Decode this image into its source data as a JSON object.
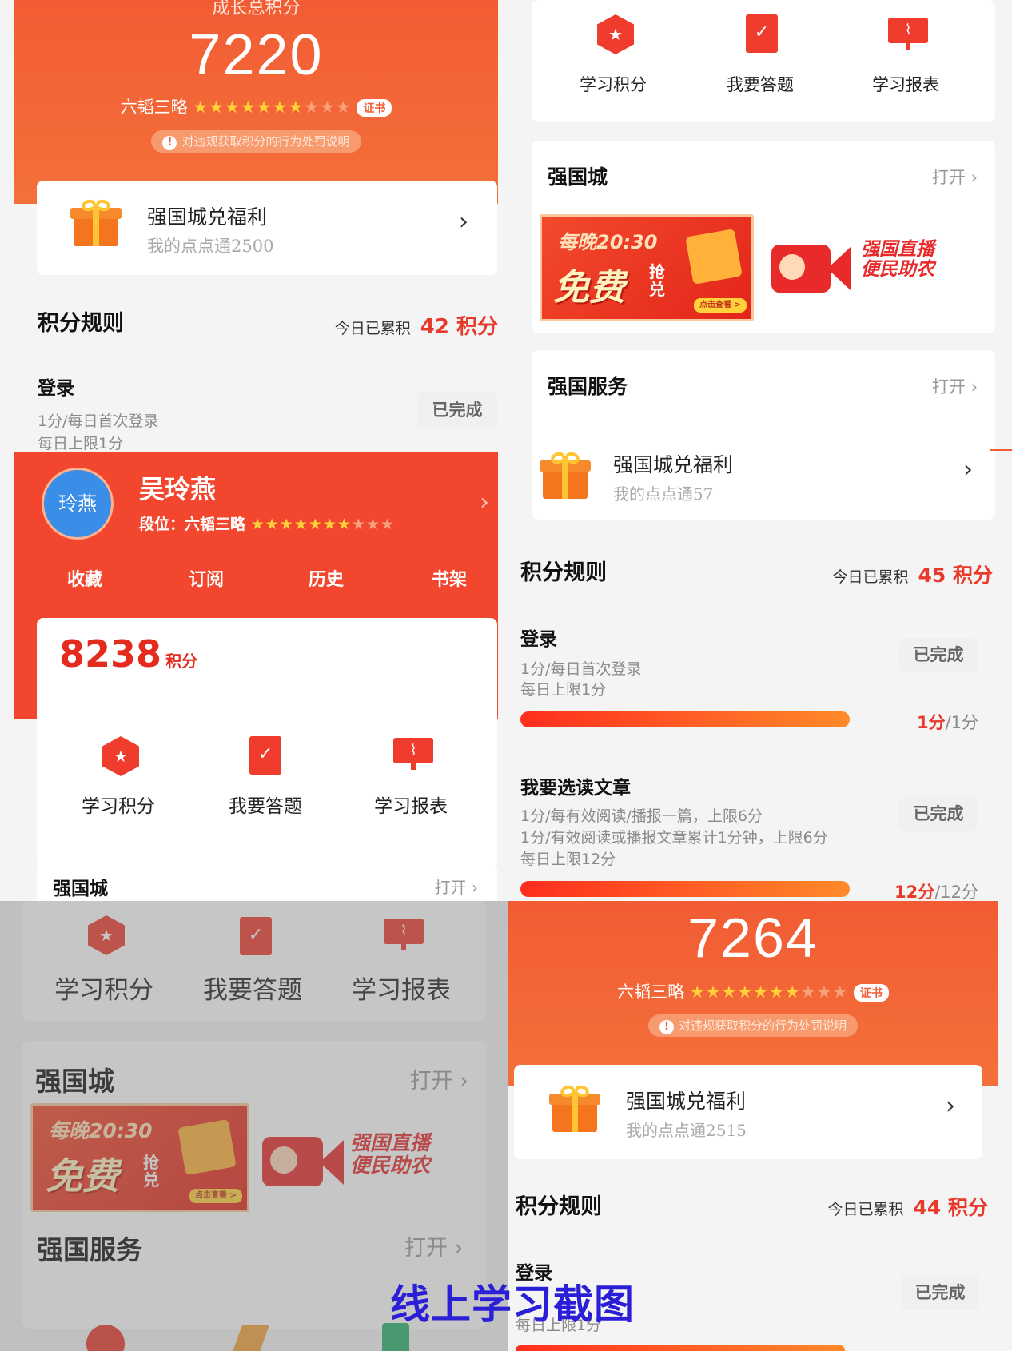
{
  "tl": {
    "hero_label": "成长总积分",
    "score": "7220",
    "rank": "六韬三略",
    "cert": "证书",
    "warning": "对违规获取积分的行为处罚说明",
    "welfare_title": "强国城兑福利",
    "welfare_sub": "我的点点通2500",
    "rules_title": "积分规则",
    "today_prefix": "今日已累积",
    "today_value": "42 积分",
    "login_title": "登录",
    "login_desc1": "1分/每日首次登录",
    "login_desc2": "每日上限1分",
    "done": "已完成"
  },
  "ml": {
    "avatar": "玲燕",
    "name": "吴玲燕",
    "rank_label": "段位：六韬三略",
    "tabs": [
      "收藏",
      "订阅",
      "历史",
      "书架"
    ],
    "score": "8238",
    "score_unit": "积分",
    "icons": [
      "学习积分",
      "我要答题",
      "学习报表"
    ],
    "city": "强国城",
    "open": "打开 ›"
  },
  "bl": {
    "icons": [
      "学习积分",
      "我要答题",
      "学习报表"
    ],
    "city": "强国城",
    "open": "打开 ›",
    "banner_time": "每晚20:30",
    "banner_free": "免费",
    "banner_grab": "抢兑",
    "banner_btn": "点击查看 >",
    "live_text": "强国直播 便民助农",
    "service": "强国服务",
    "service_open": "打开 ›"
  },
  "tr": {
    "icons": [
      "学习积分",
      "我要答题",
      "学习报表"
    ],
    "city": "强国城",
    "open": "打开 ›",
    "banner_time": "每晚20:30",
    "banner_free": "免费",
    "banner_grab": "抢兑",
    "banner_btn": "点击查看 >",
    "live_text": "强国直播 便民助农",
    "service": "强国服务",
    "service_open": "打开 ›",
    "welfare_title": "强国城兑福利",
    "welfare_sub": "我的点点通57",
    "rules_title": "积分规则",
    "today_prefix": "今日已累积",
    "today_value": "45 积分",
    "login_title": "登录",
    "login_desc1": "1分/每日首次登录",
    "login_desc2": "每日上限1分",
    "login_progress": "1分",
    "login_total": "/1分",
    "login_fraction": 1.0,
    "article_title": "我要选读文章",
    "article_desc1": "1分/每有效阅读/播报一篇，上限6分",
    "article_desc2": "1分/有效阅读或播报文章累计1分钟，上限6分",
    "article_desc3": "每日上限12分",
    "article_progress": "12分",
    "article_total": "/12分",
    "article_fraction": 1.0,
    "done": "已完成"
  },
  "br": {
    "score": "7264",
    "rank": "六韬三略",
    "cert": "证书",
    "warning": "对违规获取积分的行为处罚说明",
    "welfare_title": "强国城兑福利",
    "welfare_sub": "我的点点通2515",
    "rules_title": "积分规则",
    "today_prefix": "今日已累积",
    "today_value": "44 积分",
    "login_title": "登录",
    "login_desc2": "每日上限1分",
    "done": "已完成"
  },
  "caption": "线上学习截图",
  "colors": {
    "accent": "#f25c34",
    "red_text": "#e83a2a",
    "caption": "#2a1fd6"
  }
}
